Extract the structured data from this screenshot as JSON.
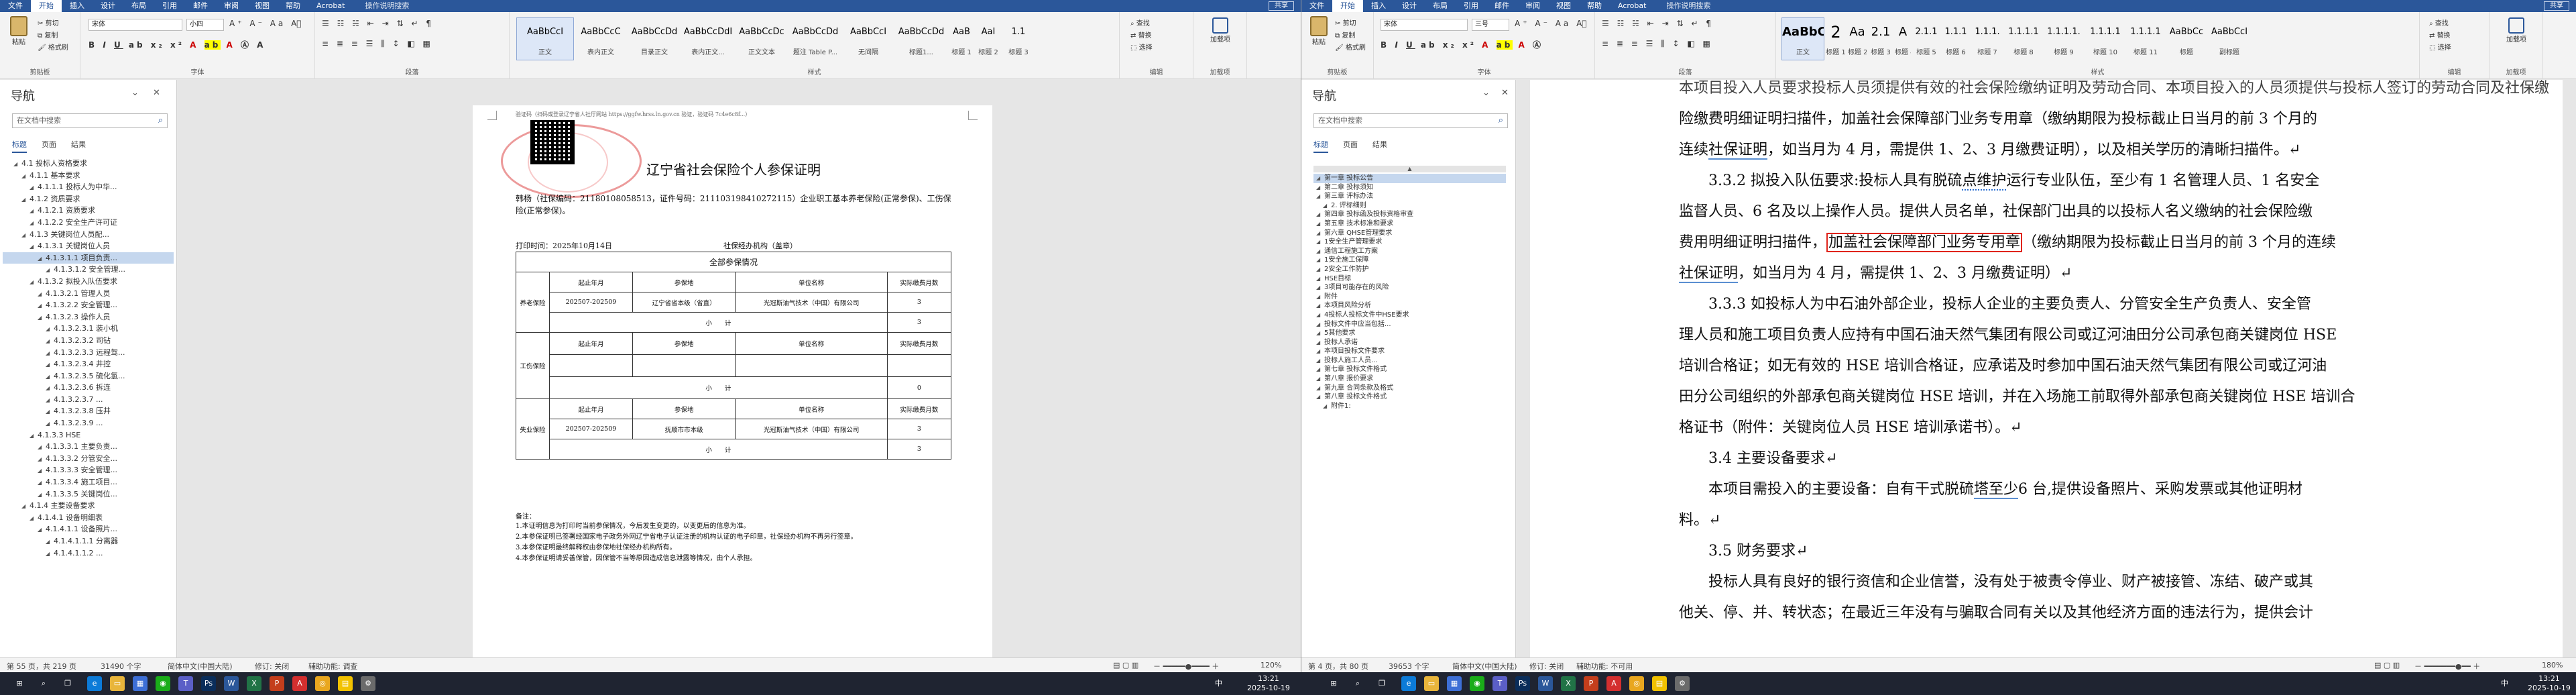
{
  "left": {
    "tabs": [
      "文件",
      "开始",
      "插入",
      "设计",
      "布局",
      "引用",
      "邮件",
      "审阅",
      "视图",
      "帮助",
      "Acrobat"
    ],
    "active_tab": "开始",
    "search": "操作说明搜索",
    "share": "共享",
    "font_name": "宋体",
    "font_size": "小四",
    "groups": {
      "clipboard": "剪贴板",
      "font": "字体",
      "paragraph": "段落",
      "styles": "样式",
      "editing": "编辑",
      "addin": "加载项"
    },
    "clipboard": {
      "paste": "粘贴",
      "cut": "剪切",
      "copy": "复制",
      "painter": "格式刷"
    },
    "editing": {
      "find": "查找",
      "replace": "替换",
      "select": "选择"
    },
    "addin": "加载项",
    "styles": [
      {
        "p": "AaBbCcI",
        "n": "正文"
      },
      {
        "p": "AaBbCcC",
        "n": "表内正文"
      },
      {
        "p": "AaBbCcDd",
        "n": "目录正文"
      },
      {
        "p": "AaBbCcDdI",
        "n": "表内正文..."
      },
      {
        "p": "AaBbCcDc",
        "n": "正文文本"
      },
      {
        "p": "AaBbCcDd",
        "n": "题注 Table P..."
      },
      {
        "p": "AaBbCcI",
        "n": "无间隔"
      },
      {
        "p": "AaBbCcDd",
        "n": "标题1..."
      },
      {
        "p": "AaB",
        "n": "标题 1"
      },
      {
        "p": "AaI",
        "n": "标题 2"
      },
      {
        "p": "1.1",
        "n": "标题 3"
      }
    ]
  },
  "left_nav": {
    "title": "导航",
    "search_placeholder": "在文档中搜索",
    "tabs": [
      "标题",
      "页面",
      "结果"
    ],
    "items": [
      "4.1 投标人资格要求",
      "4.1.1 基本要求",
      "4.1.1.1 投标人为中华...",
      "4.1.2 资质要求",
      "4.1.2.1 资质要求",
      "4.1.2.2 安全生产许可证",
      "4.1.3 关键岗位人员配...",
      "4.1.3.1 关键岗位人员",
      "4.1.3.1.1 项目负责...",
      "4.1.3.1.2 安全管理...",
      "4.1.3.2 拟投入队伍要求",
      "4.1.3.2.1 管理人员",
      "4.1.3.2.2 安全管理...",
      "4.1.3.2.3 操作人员",
      "4.1.3.2.3.1 装小机",
      "4.1.3.2.3.2 司钻",
      "4.1.3.2.3.3 远程驾...",
      "4.1.3.2.3.4 井控",
      "4.1.3.2.3.5 硫化氢...",
      "4.1.3.2.3.6 拆连",
      "4.1.3.2.3.7 ...",
      "4.1.3.2.3.8 压井",
      "4.1.3.2.3.9 ...",
      "4.1.3.3 HSE",
      "4.1.3.3.1 主要负责...",
      "4.1.3.3.2 分管安全...",
      "4.1.3.3.3 安全管理...",
      "4.1.3.3.4 施工项目...",
      "4.1.3.3.5 关键岗位...",
      "4.1.4 主要设备要求",
      "4.1.4.1 设备明细表",
      "4.1.4.1.1 设备照片...",
      "4.1.4.1.1.1 分离器",
      "4.1.4.1.1.2 ..."
    ],
    "indent": [
      1,
      2,
      3,
      2,
      3,
      3,
      2,
      3,
      4,
      5,
      3,
      4,
      4,
      4,
      5,
      5,
      5,
      5,
      5,
      5,
      5,
      5,
      5,
      3,
      4,
      4,
      4,
      4,
      4,
      2,
      3,
      4,
      5,
      5
    ],
    "selected": 8
  },
  "certificate": {
    "header_note": "验证码（扫码或登录辽宁省人社厅网站 https://ggfw.hrss.ln.gov.cn 验证，验证码 7c4e6c8f...）",
    "title": "辽宁省社会保险个人参保证明",
    "person_line": "韩杨（社保编码：21180108058513，证件号码：211103198410272115）企业职工基本养老保险(正常参保)、工伤保险(正常参保)。",
    "print_time": "打印时间：2025年10月14日",
    "agency": "社保经办机构（盖章）",
    "table_title": "全部参保情况",
    "col_headers": [
      "起止年月",
      "参保地",
      "单位名称",
      "实际缴费月数"
    ],
    "rows": [
      {
        "label": "养老保险",
        "cells": [
          "202507-202509",
          "辽宁省省本级（省直）",
          "光冠斯油气技术（中国）有限公司",
          "3"
        ],
        "subtotal": "3"
      },
      {
        "label": "工伤保险",
        "cells": [
          "",
          "",
          "",
          ""
        ],
        "subtotal": "0"
      },
      {
        "label": "失业保险",
        "cells": [
          "202507-202509",
          "抚顺市市本级",
          "光冠斯油气技术（中国）有限公司",
          "3"
        ],
        "subtotal": "3"
      }
    ],
    "subtotal_label": "小　　计",
    "notes_title": "备注：",
    "notes": [
      "1.本证明信息为打印时当前参保情况，今后发生变更的，以变更后的信息为准。",
      "2.本参保证明已签署经国家电子政务外网辽宁省电子认证注册的机构认证的电子印章，社保经办机构不再另行签章。",
      "3.本参保证明最终解释权由参保地社保经办机构所有。",
      "4.本参保证明请妥善保管，因保管不当等原因造成信息泄露等情况，由个人承担。"
    ]
  },
  "left_status": {
    "page": "第 55 页，共 219 页",
    "words": "31490 个字",
    "lang": "简体中文(中国大陆)",
    "track": "修订: 关闭",
    "access": "辅助功能: 调查",
    "zoom": "120%"
  },
  "right": {
    "tabs": [
      "文件",
      "开始",
      "插入",
      "设计",
      "布局",
      "引用",
      "邮件",
      "审阅",
      "视图",
      "帮助",
      "Acrobat"
    ],
    "active_tab": "开始",
    "search": "操作说明搜索",
    "share": "共享",
    "font_name": "宋体",
    "font_size": "三号",
    "groups": {
      "clipboard": "剪贴板",
      "font": "字体",
      "paragraph": "段落",
      "styles": "样式",
      "editing": "编辑",
      "addin": "加载项"
    },
    "clipboard": {
      "paste": "粘贴",
      "cut": "剪切",
      "copy": "复制",
      "painter": "格式刷"
    },
    "editing": {
      "find": "查找",
      "replace": "替换",
      "select": "选择"
    },
    "addin": "加载项",
    "styles": [
      {
        "p": "AaBbC",
        "n": "正文"
      },
      {
        "p": "2",
        "n": "标题 1"
      },
      {
        "p": "Aa",
        "n": "标题 2"
      },
      {
        "p": "2.1",
        "n": "标题 3"
      },
      {
        "p": "A",
        "n": "标题 4"
      },
      {
        "p": "2.1.1",
        "n": "标题 5"
      },
      {
        "p": "1.1.1",
        "n": "标题 6"
      },
      {
        "p": "1.1.1.",
        "n": "标题 7"
      },
      {
        "p": "1.1.1.1",
        "n": "标题 8"
      },
      {
        "p": "1.1.1.1.",
        "n": "标题 9"
      },
      {
        "p": "1.1.1.1",
        "n": "标题 10"
      },
      {
        "p": "1.1.1.1",
        "n": "标题 11"
      },
      {
        "p": "AaBbCc",
        "n": "标题"
      },
      {
        "p": "AaBbCcI",
        "n": "副标题"
      }
    ]
  },
  "right_nav": {
    "title": "导航",
    "search_placeholder": "在文档中搜索",
    "tabs": [
      "标题",
      "页面",
      "结果"
    ],
    "items": [
      "第一章 投标公告",
      "第二章 投标须知",
      "第三章 评标办法",
      "2. 评标细则",
      "第四章 投标函及投标资格审查",
      "第五章 技术标准和要求",
      "第六章 QHSE管理要求",
      "1安全生产管理要求",
      "通信工程施工方案",
      "1安全施工保障",
      "2安全工作防护",
      "HSE目标",
      "3项目可能存在的风险",
      "附件",
      "本项目风险分析",
      "4投标人投标文件中HSE要求",
      "投标文件中应当包括...",
      "5其他要求",
      "投标人承诺",
      "本项目投标文件要求",
      "投标人施工人员...",
      "第七章 投标文件格式",
      "第八章 报价要求",
      "第九章 合同条款及格式",
      "第八章 投标文件格式",
      "附件1:"
    ],
    "indent": [
      0,
      0,
      0,
      1,
      0,
      0,
      0,
      0,
      0,
      0,
      0,
      0,
      0,
      0,
      0,
      0,
      0,
      0,
      0,
      0,
      0,
      0,
      0,
      0,
      0,
      1
    ],
    "selected": 0
  },
  "right_doc": {
    "l0": "本项目投入人员要求投标人员须提供有效的社会保险缴纳证明及劳动合同、本项目投入的人员须提供与投标人签订的劳动合同及社保缴",
    "l1": "险缴费明细证明扫描件，加盖社会保障部门业务专用章（缴纳期限为投标截止日当月的前 3 个月的",
    "l2a": "连续",
    "l2b": "社保证明",
    "l2c": "，如当月为 4 月，需提供 1、2、3 月缴费证明），以及相关学历的清晰扫描件。↵",
    "l3a": "3.3.2 拟投入队伍要求:投标人具有脱硫",
    "l3b": "点维护",
    "l3c": "运行专业队伍，至少有 1 名管理人员、1 名安全",
    "l4": "监督人员、6 名及以上操作人员。提供人员名单，社保部门出具的以投标人名义缴纳的社会保险缴",
    "l5a": "费用明细证明扫描件，",
    "l5b": "加盖社会保障部门业务专用章",
    "l5c": "（缴纳期限为投标截止日当月的前 3 个月的连续",
    "l6a": "社保证明",
    "l6b": "，如当月为 4 月，需提供 1、2、3 月缴费证明）↵",
    "l7": "3.3.3 如投标人为中石油外部企业，投标人企业的主要负责人、分管安全生产负责人、安全管",
    "l8": "理人员和施工项目负责人应持有中国石油天然气集团有限公司或辽河油田分公司承包商关键岗位 HSE",
    "l9": "培训合格证；如无有效的 HSE 培训合格证，应承诺及时参加中国石油天然气集团有限公司或辽河油",
    "l10": "田分公司组织的外部承包商关键岗位 HSE 培训，并在入场施工前取得外部承包商关键岗位 HSE 培训合",
    "l11": "格证书（附件：关键岗位人员 HSE 培训承诺书）。↵",
    "l12": "3.4 主要设备要求↵",
    "l13a": "本项目需投入的主要设备：自有干式脱硫",
    "l13b": "塔至少",
    "l13c": "6 台,提供设备照片、采购发票或其他证明材",
    "l14": "料。↵",
    "l15": "3.5 财务要求↵",
    "l16": "投标人具有良好的银行资信和企业信誉，没有处于被责令停业、财产被接管、冻结、破产或其",
    "l17": "他关、停、并、转状态；在最近三年没有与骗取合同有关以及其他经济方面的违法行为，提供会计"
  },
  "right_status": {
    "page": "第 4 页，共 80 页",
    "words": "39653 个字",
    "lang": "简体中文(中国大陆)",
    "track": "修订: 关闭",
    "access": "辅助功能: 不可用",
    "zoom": "180%"
  },
  "taskbar": {
    "time_left": "13:21",
    "date_left": "2025-10-19",
    "time_right": "13:21",
    "date_right": "2025-10-19",
    "lang_left": "中",
    "lang_right": "中",
    "icons": [
      "windows-start",
      "search",
      "task-view",
      "edge",
      "explorer",
      "store",
      "wechat",
      "teams",
      "photoshop",
      "word",
      "excel",
      "powerpoint",
      "acrobat",
      "chrome",
      "notes",
      "settings"
    ]
  }
}
